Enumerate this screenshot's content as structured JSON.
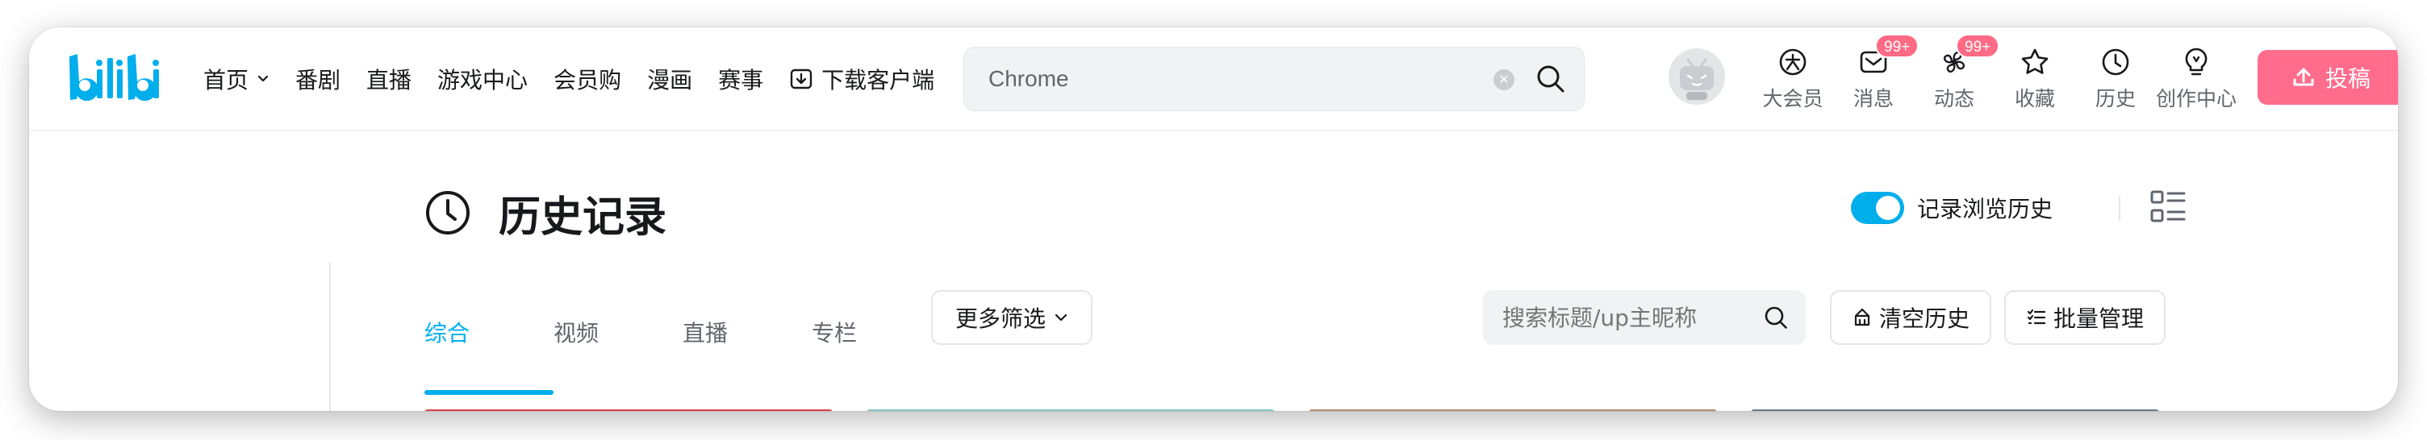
{
  "header": {
    "logo_alt": "bilibili",
    "nav": [
      {
        "label": "首页",
        "has_dropdown": true
      },
      {
        "label": "番剧"
      },
      {
        "label": "直播"
      },
      {
        "label": "游戏中心"
      },
      {
        "label": "会员购"
      },
      {
        "label": "漫画"
      },
      {
        "label": "赛事"
      },
      {
        "label": "下载客户端",
        "icon": "download-icon"
      }
    ],
    "search": {
      "value": "Chrome",
      "clear_icon": "clear-icon",
      "search_icon": "search-icon"
    },
    "entries": [
      {
        "label": "大会员",
        "icon": "vip-icon"
      },
      {
        "label": "消息",
        "icon": "message-icon",
        "badge": "99+"
      },
      {
        "label": "动态",
        "icon": "dynamic-icon",
        "badge": "99+"
      },
      {
        "label": "收藏",
        "icon": "star-icon"
      },
      {
        "label": "历史",
        "icon": "history-icon"
      },
      {
        "label": "创作中心",
        "icon": "bulb-icon"
      }
    ],
    "upload_label": "投稿"
  },
  "page": {
    "title": "历史记录",
    "record_toggle_label": "记录浏览历史",
    "record_toggle_on": true,
    "tabs": [
      {
        "label": "综合",
        "active": true
      },
      {
        "label": "视频"
      },
      {
        "label": "直播"
      },
      {
        "label": "专栏"
      }
    ],
    "more_filter_label": "更多筛选",
    "search_placeholder": "搜索标题/up主昵称",
    "clear_history_label": "清空历史",
    "batch_manage_label": "批量管理"
  },
  "colors": {
    "brand": "#00aeec",
    "upload": "#ff6c8c",
    "badge": "#ff6a85",
    "text_primary": "#18191c",
    "text_secondary": "#61666d"
  }
}
